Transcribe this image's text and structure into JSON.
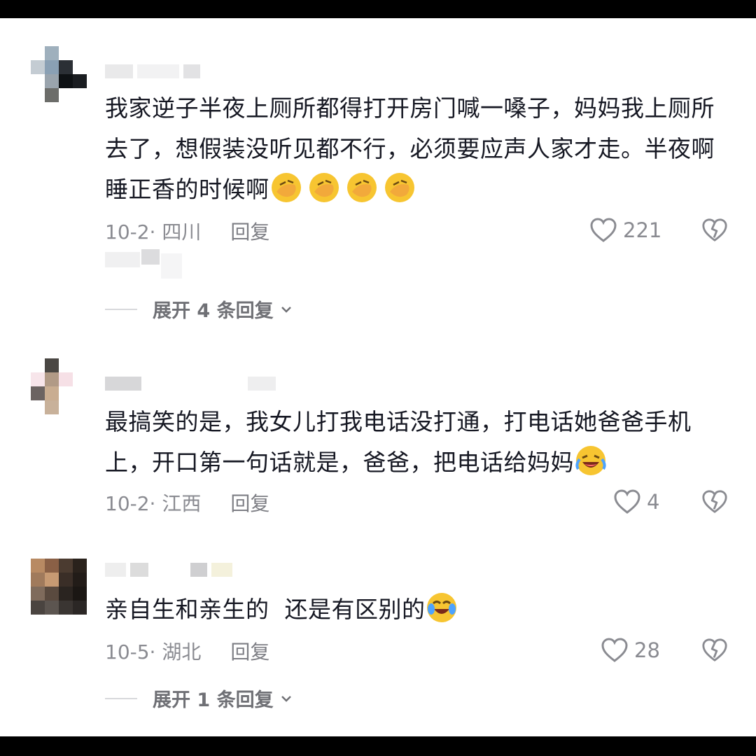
{
  "comments": [
    {
      "text": "我家逆子半夜上厕所都得打开房门喊一嗓子，妈妈我上厕所去了，想假装没听见都不行，必须要应声人家才走。半夜啊睡正香的时候啊",
      "emoji": "facepalm-emoji",
      "date_loc": "10-2· 四川",
      "reply_label": "回复",
      "likes": "221",
      "expand_label": "展开 4 条回复"
    },
    {
      "text": "最搞笑的是，我女儿打我电话没打通，打电话她爸爸手机上，开口第一句话就是，爸爸，把电话给妈妈",
      "emoji": "laughing-crying-emoji",
      "date_loc": "10-2· 江西",
      "reply_label": "回复",
      "likes": "4"
    },
    {
      "text": "亲自生和亲生的  还是有区别的",
      "emoji": "tears-of-joy-emoji",
      "date_loc": "10-5· 湖北",
      "reply_label": "回复",
      "likes": "28",
      "expand_label": "展开 1 条回复"
    }
  ],
  "colors": {
    "text": "#161823",
    "meta": "#8a8b91",
    "emoji": "#f7c531"
  }
}
